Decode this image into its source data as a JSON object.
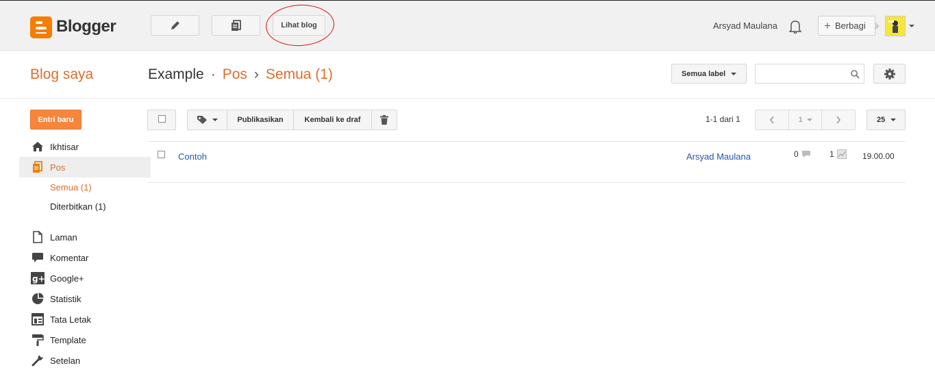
{
  "header": {
    "logo_text": "Blogger",
    "view_blog_label": "Lihat blog",
    "username": "Arsyad Maulana",
    "share_label": "Berbagi",
    "colors": {
      "brand": "#f57d00",
      "bar": "#f1f1f1"
    }
  },
  "subheader": {
    "my_blogs": "Blog saya",
    "blog_name": "Example",
    "sep_dot": "·",
    "section": "Pos",
    "sep_arrow": "›",
    "filter": "Semua (1)",
    "label_dropdown": "Semua label",
    "search_placeholder": ""
  },
  "sidebar": {
    "new_entry": "Entri baru",
    "items": [
      {
        "label": "Ikhtisar",
        "icon": "home-icon"
      },
      {
        "label": "Pos",
        "icon": "posts-icon",
        "active": true
      },
      {
        "label": "Laman",
        "icon": "page-icon"
      },
      {
        "label": "Komentar",
        "icon": "comment-icon"
      },
      {
        "label": "Google+",
        "icon": "google-plus-icon"
      },
      {
        "label": "Statistik",
        "icon": "pie-chart-icon"
      },
      {
        "label": "Tata Letak",
        "icon": "layout-icon"
      },
      {
        "label": "Template",
        "icon": "paint-roller-icon"
      },
      {
        "label": "Setelan",
        "icon": "wrench-icon"
      }
    ],
    "subitems": [
      {
        "label": "Semua (1)",
        "active": true
      },
      {
        "label": "Diterbitkan (1)"
      }
    ]
  },
  "toolbar": {
    "publish": "Publikasikan",
    "revert_draft": "Kembali ke draf",
    "page_info": "1-1 dari 1",
    "page_number": "1",
    "per_page": "25"
  },
  "posts": [
    {
      "title": "Contoh",
      "author": "Arsyad Maulana",
      "comments": "0",
      "views": "1",
      "time": "19.00.00"
    }
  ]
}
